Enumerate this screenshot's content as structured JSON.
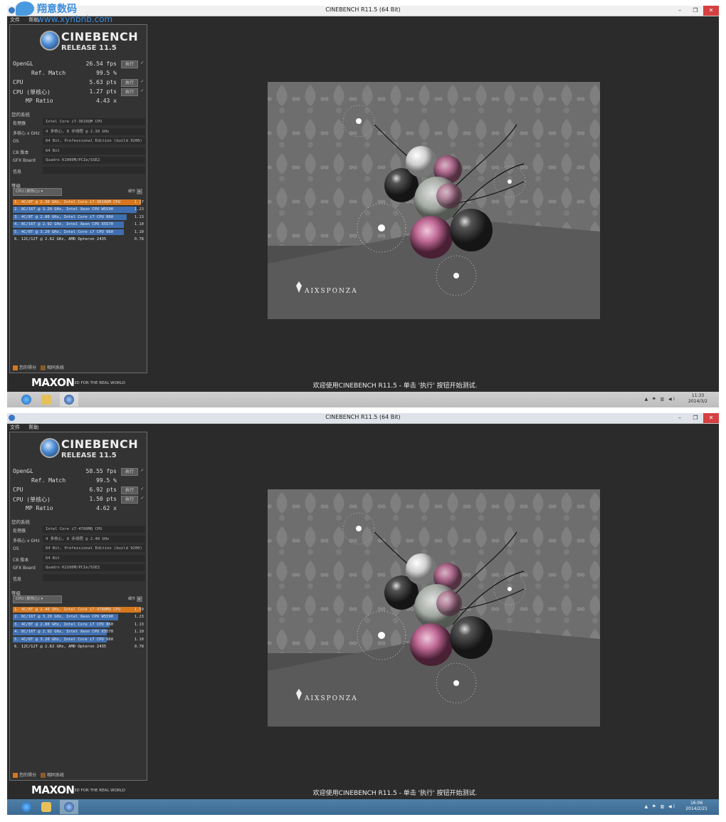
{
  "watermark": {
    "name": "翔意数码",
    "url": "www.xynbnb.com"
  },
  "colors": {
    "rank_mine": "#d4771e",
    "rank_other": "#3f6fb0",
    "taskbar_top": "#bdbdbd",
    "taskbar_bottom": "#3b6a92"
  },
  "screens": [
    {
      "window_title": "CINEBENCH R11.5 (64 Bit)",
      "menu": [
        "文件",
        "帮助"
      ],
      "logo": {
        "title": "CINEBENCH",
        "subtitle": "RELEASE 11.5"
      },
      "results": {
        "opengl_label": "OpenGL",
        "opengl_value": "26.54 fps",
        "ref_label": "Ref. Match",
        "ref_value": "99.5 %",
        "cpu_label": "CPU",
        "cpu_value": "5.63 pts",
        "cpu1_label": "CPU (单核心)",
        "cpu1_value": "1.27 pts",
        "mp_label": "MP Ratio",
        "mp_value": "4.43 x",
        "run_label": "执行",
        "check": "✓"
      },
      "system": {
        "header": "您的系统",
        "rows": [
          {
            "k": "处理器",
            "v": "Intel Core i7-3610QM CPU"
          },
          {
            "k": "多核心 x GHz",
            "v": "4 多核心, 8 步线程 @ 2.30 GHz"
          },
          {
            "k": "OS",
            "v": "64 Bit, Professional Edition (build 9200)"
          },
          {
            "k": "CB 版本",
            "v": "64 Bit"
          },
          {
            "k": "GFX Board",
            "v": "Quadro K1000M/PCIe/SSE2"
          },
          {
            "k": "信息",
            "v": ""
          }
        ]
      },
      "ranking": {
        "header": "等级",
        "select": "CPU (单核心)",
        "detail_label": "细节",
        "rows": [
          {
            "text": "1. 4C/8T @ 2.30 GHz, Intel Core i7-3610QM CPU",
            "score": "1.27",
            "value": 1.27,
            "mine": true
          },
          {
            "text": "2. 8C/16T @ 3.20 GHz, Intel Xeon CPU W5590",
            "score": "1.23",
            "value": 1.23,
            "mine": false
          },
          {
            "text": "3. 4C/8T @ 2.80 GHz, Intel Core i7 CPU 860",
            "score": "1.13",
            "value": 1.13,
            "mine": false
          },
          {
            "text": "4. 8C/16T @ 2.92 GHz, Intel Xeon CPU X5570",
            "score": "1.10",
            "value": 1.1,
            "mine": false
          },
          {
            "text": "5. 4C/8T @ 3.20 GHz, Intel Core i7 CPU 960",
            "score": "1.10",
            "value": 1.1,
            "mine": false
          },
          {
            "text": "6. 12C/12T @ 2.62 GHz, AMD Opteron 2435",
            "score": "0.78",
            "value": 0.78,
            "mine": false
          }
        ],
        "legend_mine": "您的得分",
        "legend_similar": "相同系统"
      },
      "maxon": {
        "brand": "MAXON",
        "tagline": "3D FOR THE REAL WORLD"
      },
      "render_brand": "AIXSPONZA",
      "status": "欢迎使用CINEBENCH R11.5 - 单击 '执行' 按钮开始测试.",
      "clock": {
        "time": "11:33",
        "date": "2014/3/2"
      }
    },
    {
      "window_title": "CINEBENCH R11.5 (64 Bit)",
      "menu": [
        "文件",
        "帮助"
      ],
      "logo": {
        "title": "CINEBENCH",
        "subtitle": "RELEASE 11.5"
      },
      "results": {
        "opengl_label": "OpenGL",
        "opengl_value": "58.55 fps",
        "ref_label": "Ref. Match",
        "ref_value": "99.5 %",
        "cpu_label": "CPU",
        "cpu_value": "6.92 pts",
        "cpu1_label": "CPU (单核心)",
        "cpu1_value": "1.50 pts",
        "mp_label": "MP Ratio",
        "mp_value": "4.62 x",
        "run_label": "执行",
        "check": "✓"
      },
      "system": {
        "header": "您的系统",
        "rows": [
          {
            "k": "处理器",
            "v": "Intel Core i7-4700MQ CPU"
          },
          {
            "k": "多核心 x GHz",
            "v": "4 多核心, 8 步线程 @ 2.40 GHz"
          },
          {
            "k": "OS",
            "v": "64 Bit, Professional Edition (build 9200)"
          },
          {
            "k": "CB 版本",
            "v": "64 Bit"
          },
          {
            "k": "GFX Board",
            "v": "Quadro K2100M/PCIe/SSE2"
          },
          {
            "k": "信息",
            "v": ""
          }
        ]
      },
      "ranking": {
        "header": "等级",
        "select": "CPU (单核心)",
        "detail_label": "细节",
        "rows": [
          {
            "text": "1. 4C/8T @ 2.40 GHz, Intel Core i7-4700MQ CPU",
            "score": "1.50",
            "value": 1.5,
            "mine": true
          },
          {
            "text": "2. 8C/16T @ 3.20 GHz, Intel Xeon CPU W5590",
            "score": "1.23",
            "value": 1.23,
            "mine": false
          },
          {
            "text": "3. 4C/8T @ 2.80 GHz, Intel Core i7 CPU 860",
            "score": "1.13",
            "value": 1.13,
            "mine": false
          },
          {
            "text": "4. 8C/16T @ 2.92 GHz, Intel Xeon CPU X5570",
            "score": "1.10",
            "value": 1.1,
            "mine": false
          },
          {
            "text": "5. 4C/8T @ 3.20 GHz, Intel Core i7 CPU 960",
            "score": "1.10",
            "value": 1.1,
            "mine": false
          },
          {
            "text": "6. 12C/12T @ 2.62 GHz, AMD Opteron 2435",
            "score": "0.78",
            "value": 0.78,
            "mine": false
          }
        ],
        "legend_mine": "您的得分",
        "legend_similar": "相同系统"
      },
      "maxon": {
        "brand": "MAXON",
        "tagline": "3D FOR THE REAL WORLD"
      },
      "render_brand": "AIXSPONZA",
      "status": "欢迎使用CINEBENCH R11.5 - 单击 '执行' 按钮开始测试.",
      "clock": {
        "time": "16:06",
        "date": "2014/2/21"
      }
    }
  ]
}
